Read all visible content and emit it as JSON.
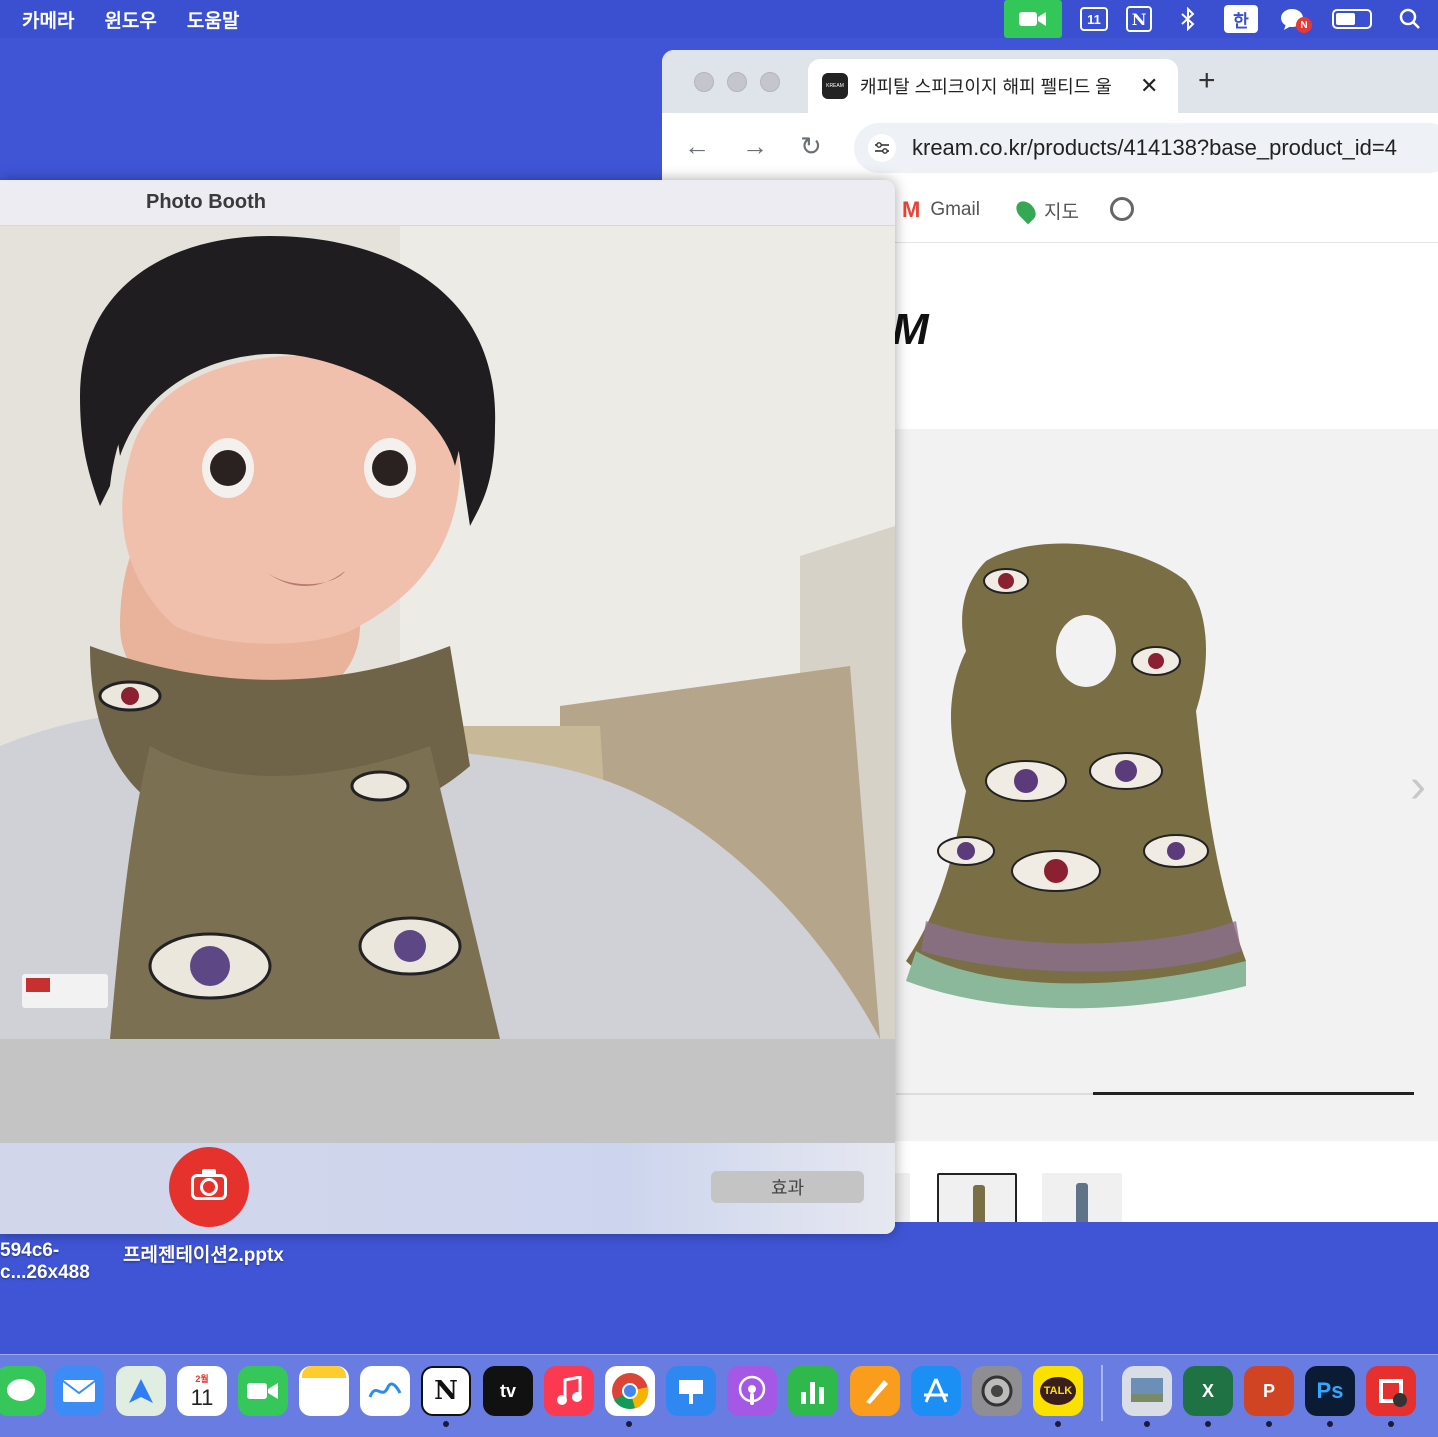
{
  "menubar": {
    "menus": [
      "카메라",
      "윈도우",
      "도움말"
    ],
    "status": {
      "calendar_day": "11",
      "notion": "N",
      "input_source": "한",
      "kakao_badge": "N"
    }
  },
  "browser": {
    "tab_title": "캐피탈 스피크이지 해피 펠티드 울 ",
    "tab_close": "✕",
    "new_tab": "+",
    "favicon_text": "KREAM",
    "url": "kream.co.kr/products/414138?base_product_id=4",
    "bookmarks": [
      {
        "label": "Gmail",
        "icon": "gmail-icon"
      },
      {
        "label": "지도",
        "icon": "maps-icon"
      }
    ],
    "logo_fragment": "M",
    "nav": {
      "back": "←",
      "forward": "→",
      "reload": "↻"
    },
    "carousel_next": "›",
    "carousel_progress": 0.62
  },
  "photobooth": {
    "title": "Photo Booth",
    "effects_label": "효과"
  },
  "desktop_files": [
    {
      "line1": "594c6-",
      "line2": "c...26x488"
    },
    {
      "line1": "프레젠테이션2.pptx"
    }
  ],
  "dock": {
    "calendar_month": "2월",
    "calendar_day": "11",
    "notion": "N",
    "appletv": "tv",
    "kakao": "TALK",
    "excel": "X",
    "powerpoint": "P",
    "photoshop": "Ps"
  },
  "colors": {
    "desktop": "#3f55d6",
    "facetime": "#33c759",
    "shutter": "#e6322d"
  }
}
